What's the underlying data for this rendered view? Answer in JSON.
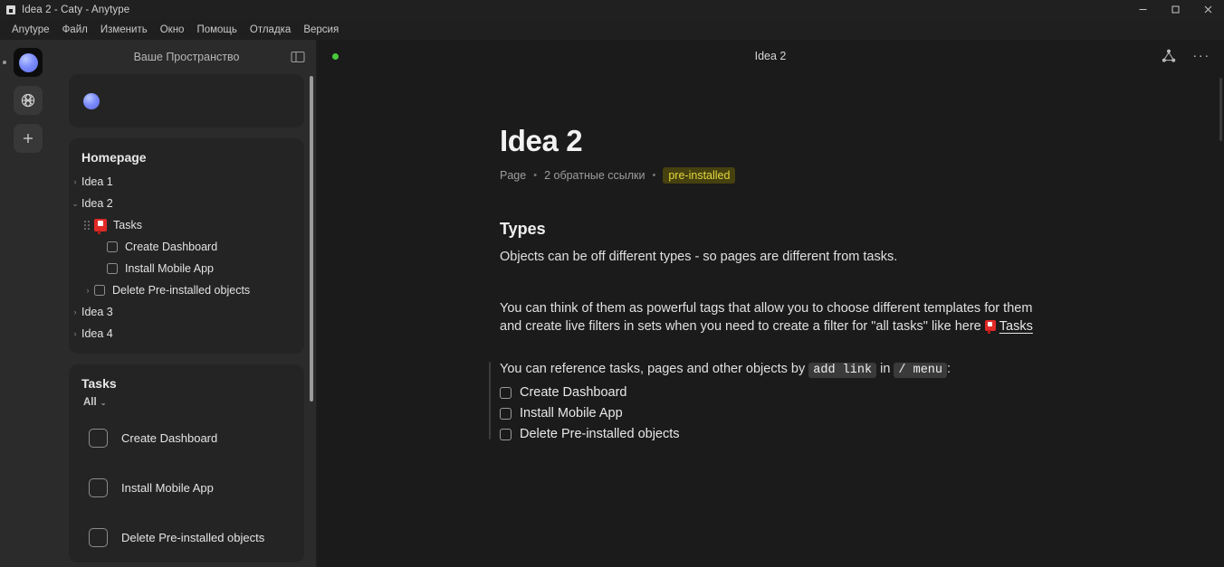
{
  "window": {
    "title": "Idea 2 - Caty - Anytype",
    "app_icon": "app-icon",
    "controls": {
      "minimize": "─",
      "maximize": "□",
      "close": "✕"
    }
  },
  "menubar": {
    "items": [
      "Anytype",
      "Файл",
      "Изменить",
      "Окно",
      "Помощь",
      "Отладка",
      "Версия"
    ]
  },
  "rail": {
    "space_avatar": "space-avatar",
    "buttons": [
      {
        "name": "globe-icon",
        "label": ""
      },
      {
        "name": "plus-icon",
        "label": "+"
      }
    ]
  },
  "sidebar": {
    "header_title": "Ваше Пространство",
    "toggle_icon": "sidebar-toggle-icon",
    "homepage": {
      "title": "Homepage",
      "tree": [
        {
          "label": "Idea 1",
          "chevron": "›",
          "indent": 0,
          "kind": "page"
        },
        {
          "label": "Idea 2",
          "chevron": "⌄",
          "indent": 0,
          "kind": "page",
          "expanded": true
        },
        {
          "label": "Tasks",
          "chevron": "",
          "indent": 0,
          "kind": "set",
          "drag": true
        },
        {
          "label": "Create Dashboard",
          "chevron": "",
          "indent": 1,
          "kind": "task"
        },
        {
          "label": "Install Mobile App",
          "chevron": "",
          "indent": 1,
          "kind": "task"
        },
        {
          "label": "Delete Pre-installed objects",
          "chevron": "›",
          "indent": 1,
          "kind": "task"
        },
        {
          "label": "Idea 3",
          "chevron": "›",
          "indent": 0,
          "kind": "page"
        },
        {
          "label": "Idea 4",
          "chevron": "›",
          "indent": 0,
          "kind": "page"
        }
      ]
    },
    "tasks_widget": {
      "title": "Tasks",
      "filter": "All",
      "filter_chevron": "⌄",
      "items": [
        {
          "label": "Create Dashboard"
        },
        {
          "label": "Install Mobile App"
        },
        {
          "label": "Delete Pre-installed objects"
        }
      ]
    }
  },
  "main": {
    "sync_status": "online",
    "header_title": "Idea 2",
    "actions": [
      {
        "name": "graph-relations-icon",
        "label": ""
      },
      {
        "name": "more-options-icon",
        "label": "···"
      }
    ],
    "doc": {
      "title": "Idea 2",
      "meta": {
        "type": "Page",
        "backlinks": "2 обратные ссылки",
        "badge": "pre-installed",
        "separator": "•"
      },
      "heading": "Types",
      "paragraph_1": "Objects can be off different types - so pages are different from tasks.",
      "paragraph_2_part1": "You can think of them as powerful tags that allow you to choose different templates for them and create live filters in sets when you need to create a filter for \"all tasks\" like here ",
      "paragraph_2_link": "Tasks",
      "paragraph_3_part1": "You can reference tasks, pages and other objects by ",
      "paragraph_3_code1": "add link",
      "paragraph_3_part2": " in ",
      "paragraph_3_code2": "/ menu",
      "paragraph_3_part3": ":",
      "checklist": [
        {
          "label": "Create Dashboard",
          "checked": false
        },
        {
          "label": "Install Mobile App",
          "checked": false
        },
        {
          "label": "Delete Pre-installed objects",
          "checked": false
        }
      ]
    }
  },
  "colors": {
    "accent_blue": "#7e8dfb",
    "sync_green": "#4bc93b",
    "badge_bg": "#46410f",
    "badge_text": "#e4d83f",
    "tasks_red": "#e02a26"
  }
}
